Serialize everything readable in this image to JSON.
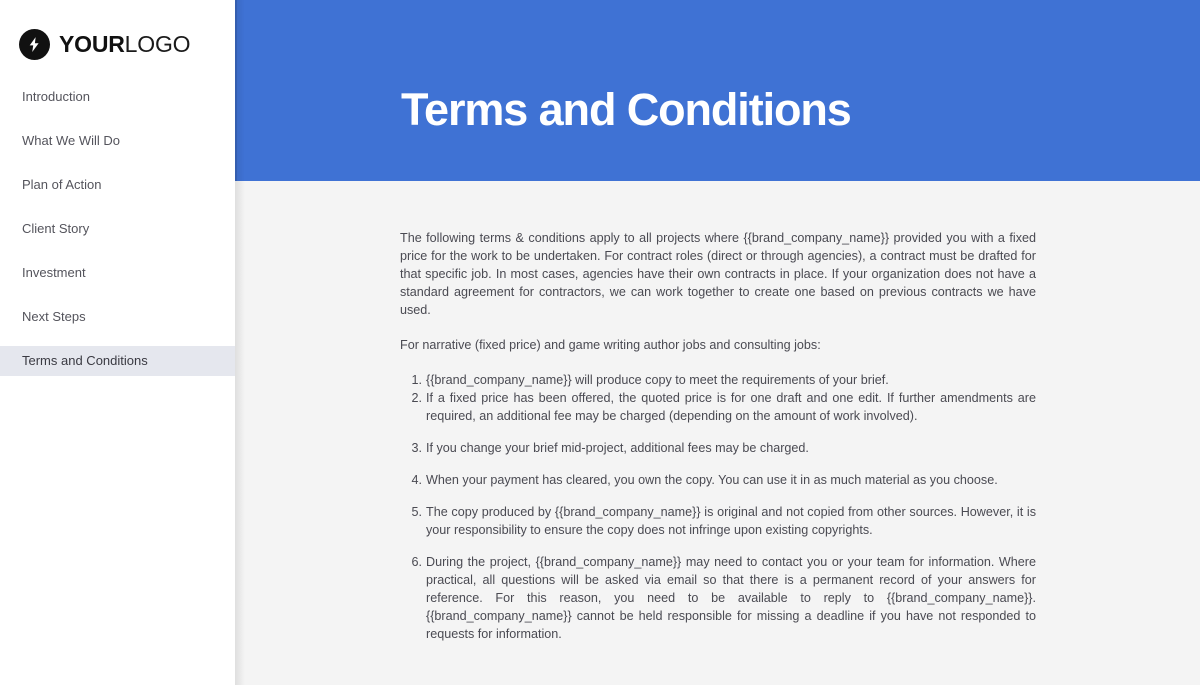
{
  "brand": {
    "logo_icon": "lightning-bolt-icon",
    "name_bold": "YOUR",
    "name_light": "LOGO"
  },
  "sidebar": {
    "items": [
      {
        "label": "Introduction",
        "active": false
      },
      {
        "label": "What We Will Do",
        "active": false
      },
      {
        "label": "Plan of Action",
        "active": false
      },
      {
        "label": "Client Story",
        "active": false
      },
      {
        "label": "Investment",
        "active": false
      },
      {
        "label": "Next Steps",
        "active": false
      },
      {
        "label": "Terms and Conditions",
        "active": true
      }
    ]
  },
  "banner": {
    "title": "Terms and Conditions",
    "background_color": "#3f72d4",
    "text_color": "#ffffff"
  },
  "content": {
    "intro_paragraph": "The following terms & conditions apply to all projects where {{brand_company_name}}  provided you with a fixed price for the work to be undertaken. For contract roles (direct or through agencies), a contract must be drafted for that specific job. In most cases, agencies have their own contracts in place. If your organization does not have a standard agreement for contractors, we can work together to create one based on previous contracts we have used.",
    "section_lead": "For narrative (fixed price) and game writing author jobs and consulting jobs:",
    "terms": [
      "{{brand_company_name}}  will produce copy to meet the requirements of your brief.",
      "If a fixed price has been offered, the quoted price is for one draft and one edit. If further amendments are required, an additional fee may be charged (depending on the amount of work involved).",
      "If you change your brief mid-project, additional fees may be charged.",
      "When your payment has cleared, you own the copy. You can use it in as much material as you choose.",
      "The copy produced by {{brand_company_name}}  is original and not copied from other sources. However, it is your responsibility to ensure the copy does not infringe upon existing copyrights.",
      "During the project, {{brand_company_name}}  may need to contact you or your team for information. Where practical, all questions will be asked via email so that there is a permanent record of your answers for reference. For this reason, you need to be available to reply to {{brand_company_name}}. {{brand_company_name}}  cannot be held responsible for missing a deadline if you have not responded to requests for information."
    ]
  },
  "theme": {
    "accent": "#3f72d4",
    "page_background": "#f4f4f4",
    "sidebar_background": "#ffffff",
    "sidebar_active_background": "#e5e7ee",
    "body_text": "#4a4a52",
    "nav_text": "#54545c"
  }
}
